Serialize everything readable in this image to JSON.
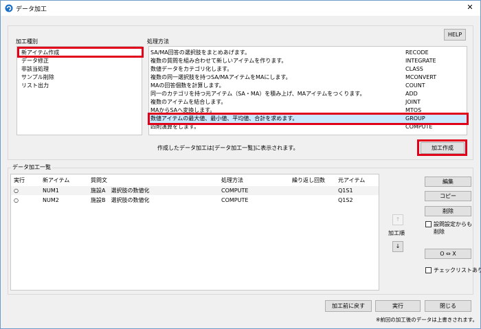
{
  "window": {
    "title": "データ加工",
    "close_glyph": "✕"
  },
  "help_label": "HELP",
  "kind": {
    "heading": "加工種別",
    "items": [
      {
        "label": "新アイテム作成",
        "selected": true
      },
      {
        "label": "データ修正"
      },
      {
        "label": "非該当処理"
      },
      {
        "label": "サンプル削除"
      },
      {
        "label": "リスト出力"
      }
    ]
  },
  "method": {
    "heading": "処理方法",
    "rows": [
      {
        "desc": "SA/MA回答の選択肢をまとめあげます。",
        "code": "RECODE"
      },
      {
        "desc": "複数の質問を組み合わせて新しいアイテムを作ります。",
        "code": "INTEGRATE"
      },
      {
        "desc": "数値データをカテゴリ化します。",
        "code": "CLASS"
      },
      {
        "desc": "複数の同一選択肢を持つSA/MAアイテムをMAにします。",
        "code": "MCONVERT"
      },
      {
        "desc": "MAの回答個数を計算します。",
        "code": "COUNT"
      },
      {
        "desc": "同一のカテゴリを持つ元アイテム（SA・MA）を積み上げ、MAアイテムをつくります。",
        "code": "ADD"
      },
      {
        "desc": "複数のアイテムを結合します。",
        "code": "JOINT"
      },
      {
        "desc": "MAからSAへ変換します。",
        "code": "MTOS"
      },
      {
        "desc": "数値アイテムの最大値、最小値、平均値、合計を求めます。",
        "code": "GROUP",
        "selected": true
      },
      {
        "desc": "四則演算をします。",
        "code": "COMPUTE"
      }
    ]
  },
  "create_note": "作成したデータ加工は[データ加工一覧]に表示されます。",
  "create_button": "加工作成",
  "list": {
    "heading": "データ加工一覧",
    "columns": [
      "実行",
      "新アイテム",
      "質問文",
      "処理方法",
      "繰り返し回数",
      "元アイテム"
    ],
    "rows": [
      {
        "run": "○",
        "new_item": "NUM1",
        "question": "施設A　選択肢の数値化",
        "method": "COMPUTE",
        "repeat": "",
        "source": "Q1S1"
      },
      {
        "run": "○",
        "new_item": "NUM2",
        "question": "施設B　選択肢の数値化",
        "method": "COMPUTE",
        "repeat": "",
        "source": "Q1S2"
      }
    ]
  },
  "order": {
    "label": "加工順",
    "up": "↑",
    "down": "↓"
  },
  "side_buttons": {
    "edit": "編集",
    "copy": "コピー",
    "delete": "削除",
    "ox": "O ⇔ X"
  },
  "checkboxes": {
    "delete_with_settings_1": "設問設定からも",
    "delete_with_settings_2": "削除",
    "checklist": "チェックリストあり"
  },
  "bottom_buttons": {
    "revert": "加工前に戻す",
    "run": "実行",
    "close": "閉じる"
  },
  "footnote": "※前回の加工後のデータは上書きされます。",
  "colors": {
    "highlight_red": "#e0001a",
    "selection_blue": "#cce8ff",
    "icon_blue": "#1a6fc8"
  }
}
